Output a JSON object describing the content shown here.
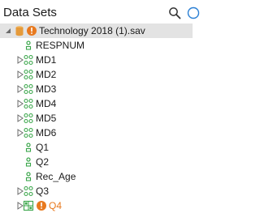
{
  "header": {
    "title": "Data Sets"
  },
  "tree": {
    "root": {
      "label": "Technology 2018 (1).sav"
    },
    "items": [
      {
        "label": "RESPNUM",
        "kind": "variable",
        "expandable": false
      },
      {
        "label": "MD1",
        "kind": "set",
        "expandable": true
      },
      {
        "label": "MD2",
        "kind": "set",
        "expandable": true
      },
      {
        "label": "MD3",
        "kind": "set",
        "expandable": true
      },
      {
        "label": "MD4",
        "kind": "set",
        "expandable": true
      },
      {
        "label": "MD5",
        "kind": "set",
        "expandable": true
      },
      {
        "label": "MD6",
        "kind": "set",
        "expandable": true
      },
      {
        "label": "Q1",
        "kind": "variable",
        "expandable": false
      },
      {
        "label": "Q2",
        "kind": "variable",
        "expandable": false
      },
      {
        "label": "Rec_Age",
        "kind": "variable",
        "expandable": false
      },
      {
        "label": "Q3",
        "kind": "set",
        "expandable": true
      },
      {
        "label": "Q4",
        "kind": "grid",
        "expandable": true,
        "warning": true
      }
    ]
  },
  "colors": {
    "accent_green": "#3aa64a",
    "warning_orange": "#e8791e",
    "database_orange": "#e59a3a",
    "selection_gray": "#e3e3e3",
    "link_blue": "#2a7fd4"
  }
}
